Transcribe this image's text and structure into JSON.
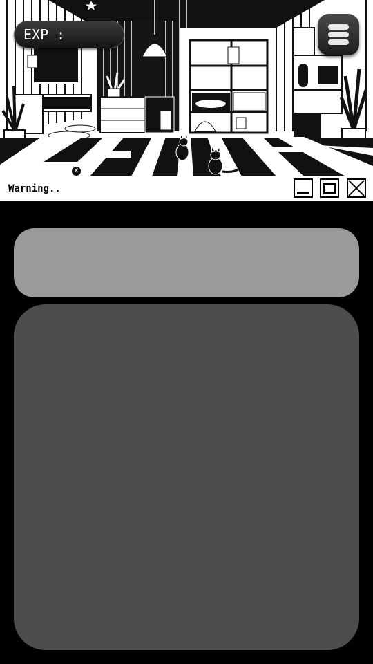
{
  "hud": {
    "exp_label": "EXP :",
    "menu_icon": "hamburger-menu-icon"
  },
  "window": {
    "title": "Warning..",
    "tab_close_icon": "close-circle-icon",
    "minimize_icon": "minimize-icon",
    "maximize_icon": "maximize-icon",
    "close_icon": "close-x-icon"
  },
  "colors": {
    "background": "#000000",
    "panel_top": "#9a9a9a",
    "panel_main": "#4d4d4d",
    "titlebar": "#ffffff"
  }
}
